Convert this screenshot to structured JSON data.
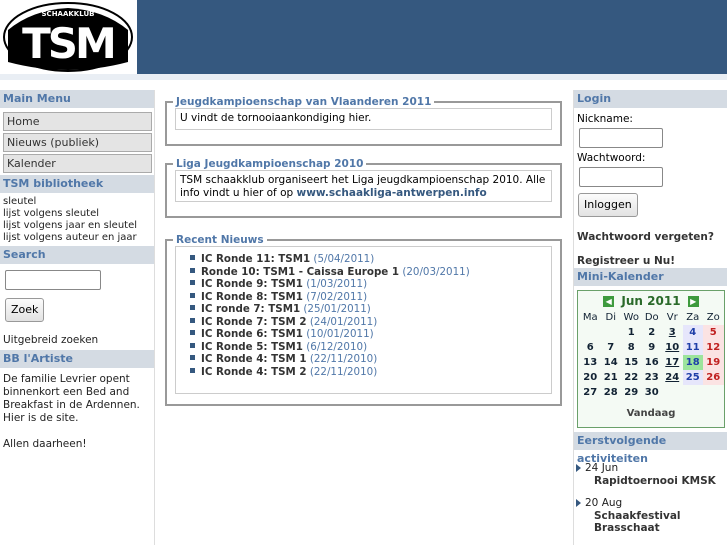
{
  "header": {
    "logo_text": "TSM",
    "logo_subtext": "SCHAAKKLUB"
  },
  "left": {
    "main_menu_title": "Main Menu",
    "menu_items": [
      "Home",
      "Nieuws (publiek)",
      "Kalender"
    ],
    "library_title": "TSM bibliotheek",
    "library_links": [
      "sleutel",
      "lijst volgens sleutel",
      "lijst volgens jaar en sleutel",
      "lijst volgens auteur en jaar"
    ],
    "search_title": "Search",
    "search_button": "Zoek",
    "advanced_search": "Uitgebreid zoeken",
    "bb_title": "BB l'Artiste",
    "bb_text": "De familie Levrier opent binnenkort een Bed and Breakfast in de Ardennen. Hier is de site.",
    "bb_text2": "Allen daarheen!"
  },
  "center": {
    "box1": {
      "title": "Jeugdkampioenschap van Vlaanderen 2011",
      "text": "U vindt de tornooiaankondiging hier."
    },
    "box2": {
      "title": "Liga Jeugdkampioenschap 2010",
      "text": "TSM schaakklub organiseert het Liga jeugdkampioenschap 2010. Alle info vindt u hier of op ",
      "link": "www.schaakliga-antwerpen.info"
    },
    "news": {
      "title": "Recent Nieuws",
      "items": [
        {
          "title": "IC Ronde 11: TSM1",
          "date": "(5/04/2011)"
        },
        {
          "title": "Ronde 10: TSM1 - Caissa Europe 1",
          "date": "(20/03/2011)"
        },
        {
          "title": "IC Ronde 9: TSM1",
          "date": "(1/03/2011)"
        },
        {
          "title": "IC Ronde 8: TSM1",
          "date": "(7/02/2011)"
        },
        {
          "title": "IC ronde 7: TSM1",
          "date": "(25/01/2011)"
        },
        {
          "title": "IC Ronde 7: TSM 2",
          "date": "(24/01/2011)"
        },
        {
          "title": "IC Ronde 6: TSM1",
          "date": "(10/01/2011)"
        },
        {
          "title": "IC Ronde 5: TSM1",
          "date": "(6/12/2010)"
        },
        {
          "title": "IC Ronde 4: TSM 1",
          "date": "(22/11/2010)"
        },
        {
          "title": "IC Ronde 4: TSM 2",
          "date": "(22/11/2010)"
        }
      ]
    }
  },
  "right": {
    "login_title": "Login",
    "nickname_label": "Nickname:",
    "password_label": "Wachtwoord:",
    "login_button": "Inloggen",
    "forgot_password": "Wachtwoord vergeten?",
    "register": "Registreer u Nu!",
    "minical_title": "Mini-Kalender",
    "calendar": {
      "month": "Jun 2011",
      "prev_arrow": "◀",
      "next_arrow": "▶",
      "weekdays": [
        "Ma",
        "Di",
        "Wo",
        "Do",
        "Vr",
        "Za",
        "Zo"
      ],
      "weeks": [
        [
          "",
          "",
          "1",
          "2",
          "3",
          "4",
          "5"
        ],
        [
          "6",
          "7",
          "8",
          "9",
          "10",
          "11",
          "12"
        ],
        [
          "13",
          "14",
          "15",
          "16",
          "17",
          "18",
          "19"
        ],
        [
          "20",
          "21",
          "22",
          "23",
          "24",
          "25",
          "26"
        ],
        [
          "27",
          "28",
          "29",
          "30",
          "",
          "",
          ""
        ]
      ],
      "today": "18",
      "event_days": [
        "3",
        "10",
        "17",
        "24"
      ],
      "footer": "Vandaag"
    },
    "activities_title": "Eerstvolgende activiteiten",
    "activities": [
      {
        "date": "24 Jun",
        "title": "Rapidtoernooi KMSK"
      },
      {
        "date": "20 Aug",
        "title": "Schaakfestival Brasschaat"
      }
    ]
  }
}
